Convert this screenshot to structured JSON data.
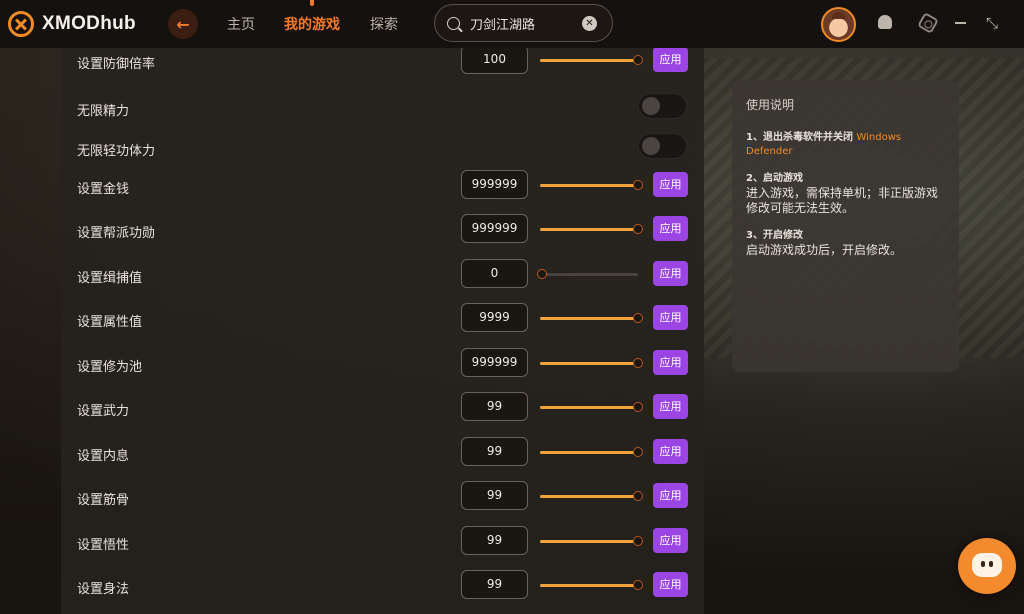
{
  "app": {
    "name": "XMODhub"
  },
  "nav": {
    "items": [
      {
        "label": "主页",
        "active": false
      },
      {
        "label": "我的游戏",
        "active": true
      },
      {
        "label": "探索",
        "active": false
      }
    ]
  },
  "search": {
    "value": "刀剑江湖路",
    "placeholder": ""
  },
  "colors": {
    "accent": "#f47a2a",
    "apply": "#9b45e4",
    "slider": "#f0a33a"
  },
  "settings": [
    {
      "label": "设置防御倍率",
      "type": "slider",
      "value": "100",
      "level": 1.0,
      "apply": "应用"
    },
    {
      "label": "无限精力",
      "type": "toggle",
      "on": false
    },
    {
      "label": "无限轻功体力",
      "type": "toggle",
      "on": false
    },
    {
      "label": "设置金钱",
      "type": "slider",
      "value": "999999",
      "level": 1.0,
      "apply": "应用"
    },
    {
      "label": "设置帮派功勋",
      "type": "slider",
      "value": "999999",
      "level": 1.0,
      "apply": "应用"
    },
    {
      "label": "设置缉捕值",
      "type": "slider",
      "value": "0",
      "level": 0.0,
      "apply": "应用"
    },
    {
      "label": "设置属性值",
      "type": "slider",
      "value": "9999",
      "level": 1.0,
      "apply": "应用"
    },
    {
      "label": "设置修为池",
      "type": "slider",
      "value": "999999",
      "level": 1.0,
      "apply": "应用"
    },
    {
      "label": "设置武力",
      "type": "slider",
      "value": "99",
      "level": 1.0,
      "apply": "应用"
    },
    {
      "label": "设置内息",
      "type": "slider",
      "value": "99",
      "level": 1.0,
      "apply": "应用"
    },
    {
      "label": "设置筋骨",
      "type": "slider",
      "value": "99",
      "level": 1.0,
      "apply": "应用"
    },
    {
      "label": "设置悟性",
      "type": "slider",
      "value": "99",
      "level": 1.0,
      "apply": "应用"
    },
    {
      "label": "设置身法",
      "type": "slider",
      "value": "99",
      "level": 1.0,
      "apply": "应用"
    }
  ],
  "help": {
    "title": "使用说明",
    "steps": [
      {
        "title": "1、退出杀毒软件并关闭",
        "link": "Windows Defender",
        "desc": ""
      },
      {
        "title": "2、启动游戏",
        "link": "",
        "desc": "进入游戏，需保持单机；非正版游戏修改可能无法生效。"
      },
      {
        "title": "3、开启修改",
        "link": "",
        "desc": "启动游戏成功后，开启修改。"
      }
    ]
  }
}
